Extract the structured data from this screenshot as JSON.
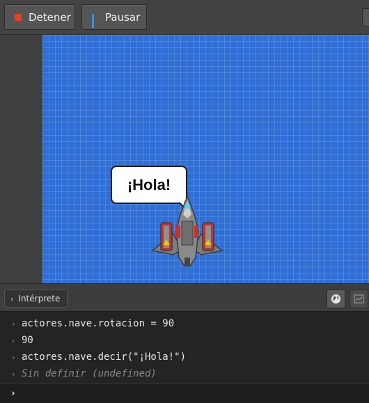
{
  "toolbar": {
    "stop_label": "Detener",
    "pause_label": "Pausar"
  },
  "stage": {
    "bubble_text": "¡Hola!",
    "sprite": "spaceship"
  },
  "console_header": {
    "tab_label": "Intérprete",
    "icons": [
      "globe-icon",
      "chart-icon"
    ]
  },
  "console": {
    "lines": [
      {
        "marker": "›",
        "text": "actores.nave.rotacion = 90"
      },
      {
        "marker": "‹",
        "text": "90"
      },
      {
        "marker": "›",
        "text": "actores.nave.decir(\"¡Hola!\")"
      },
      {
        "marker": "‹",
        "text": "Sin definir (undefined)"
      }
    ],
    "prompt_marker": "›",
    "input_value": ""
  },
  "colors": {
    "stop": "#e2461d",
    "pause": "#3a8fe0",
    "canvas": "#2f6fd6"
  }
}
